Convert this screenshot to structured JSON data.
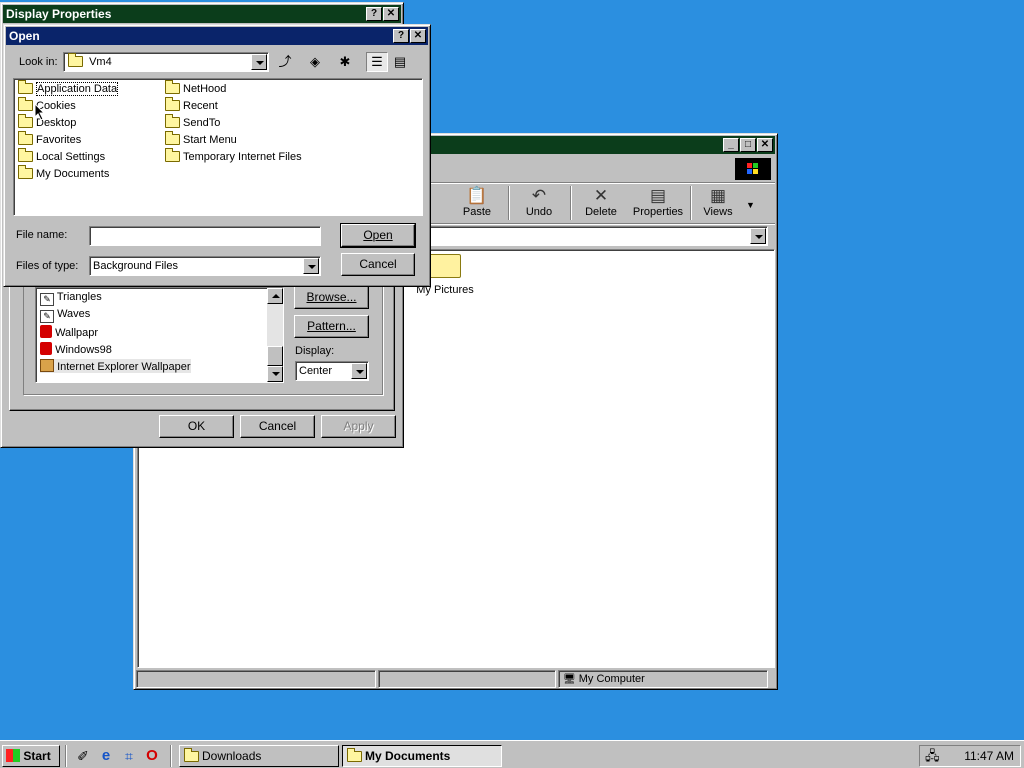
{
  "explorer": {
    "toolbar": {
      "paste": "Paste",
      "undo": "Undo",
      "delete": "Delete",
      "properties": "Properties",
      "views": "Views"
    },
    "folder_item": "My Pictures",
    "status_location": "My Computer"
  },
  "display_properties": {
    "title": "Display Properties",
    "wallpaper_list": [
      "Triangles",
      "Waves",
      "Wallpapr",
      "Windows98",
      "Internet Explorer Wallpaper"
    ],
    "browse": "Browse...",
    "pattern": "Pattern...",
    "display_label": "Display:",
    "display_value": "Center",
    "ok": "OK",
    "cancel": "Cancel",
    "apply": "Apply"
  },
  "open_dialog": {
    "title": "Open",
    "look_in_label": "Look in:",
    "look_in_value": "Vm4",
    "files_col1": [
      "Application Data",
      "Cookies",
      "Desktop",
      "Favorites",
      "Local Settings",
      "My Documents"
    ],
    "files_col2": [
      "NetHood",
      "Recent",
      "SendTo",
      "Start Menu",
      "Temporary Internet Files"
    ],
    "file_name_label": "File name:",
    "file_name_value": "",
    "files_of_type_label": "Files of type:",
    "files_of_type_value": "Background Files",
    "open": "Open",
    "cancel": "Cancel"
  },
  "taskbar": {
    "start": "Start",
    "tasks": [
      "Downloads",
      "My Documents"
    ],
    "clock": "11:47 AM"
  },
  "colors": {
    "desktop": "#2b8fe0",
    "active_title": "#0a246a",
    "inactive_title": "#0b3d1b"
  }
}
